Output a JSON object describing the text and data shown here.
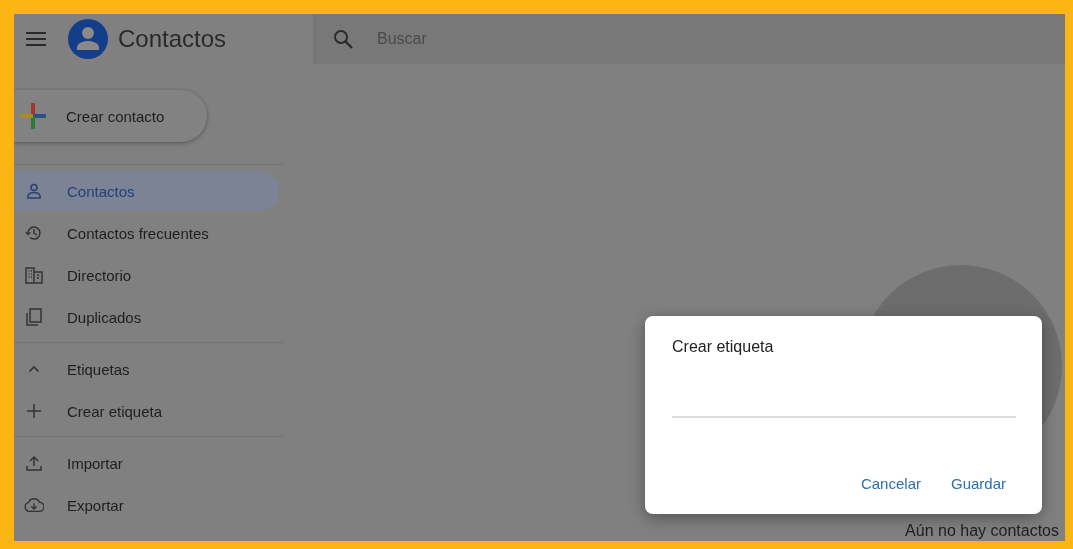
{
  "header": {
    "app_title": "Contactos",
    "search": {
      "placeholder": "Buscar"
    }
  },
  "create_button": {
    "label": "Crear contacto"
  },
  "sidebar": {
    "groups": [
      {
        "items": [
          {
            "kind": "item",
            "label": "Contactos",
            "selected": true
          },
          {
            "kind": "item",
            "label": "Contactos frecuentes",
            "selected": false
          },
          {
            "kind": "item",
            "label": "Directorio",
            "selected": false
          },
          {
            "kind": "item",
            "label": "Duplicados",
            "selected": false
          }
        ]
      },
      {
        "items": [
          {
            "kind": "section",
            "label": "Etiquetas",
            "expanded": true
          },
          {
            "kind": "item",
            "label": "Crear etiqueta",
            "selected": false
          }
        ]
      },
      {
        "items": [
          {
            "kind": "item",
            "label": "Importar",
            "selected": false
          },
          {
            "kind": "item",
            "label": "Exportar",
            "selected": false
          }
        ]
      }
    ]
  },
  "empty_state": {
    "text": "Aún no hay contactos"
  },
  "dialog": {
    "title": "Crear etiqueta",
    "buttons": [
      {
        "label": "Cancelar"
      },
      {
        "label": "Guardar"
      }
    ]
  }
}
